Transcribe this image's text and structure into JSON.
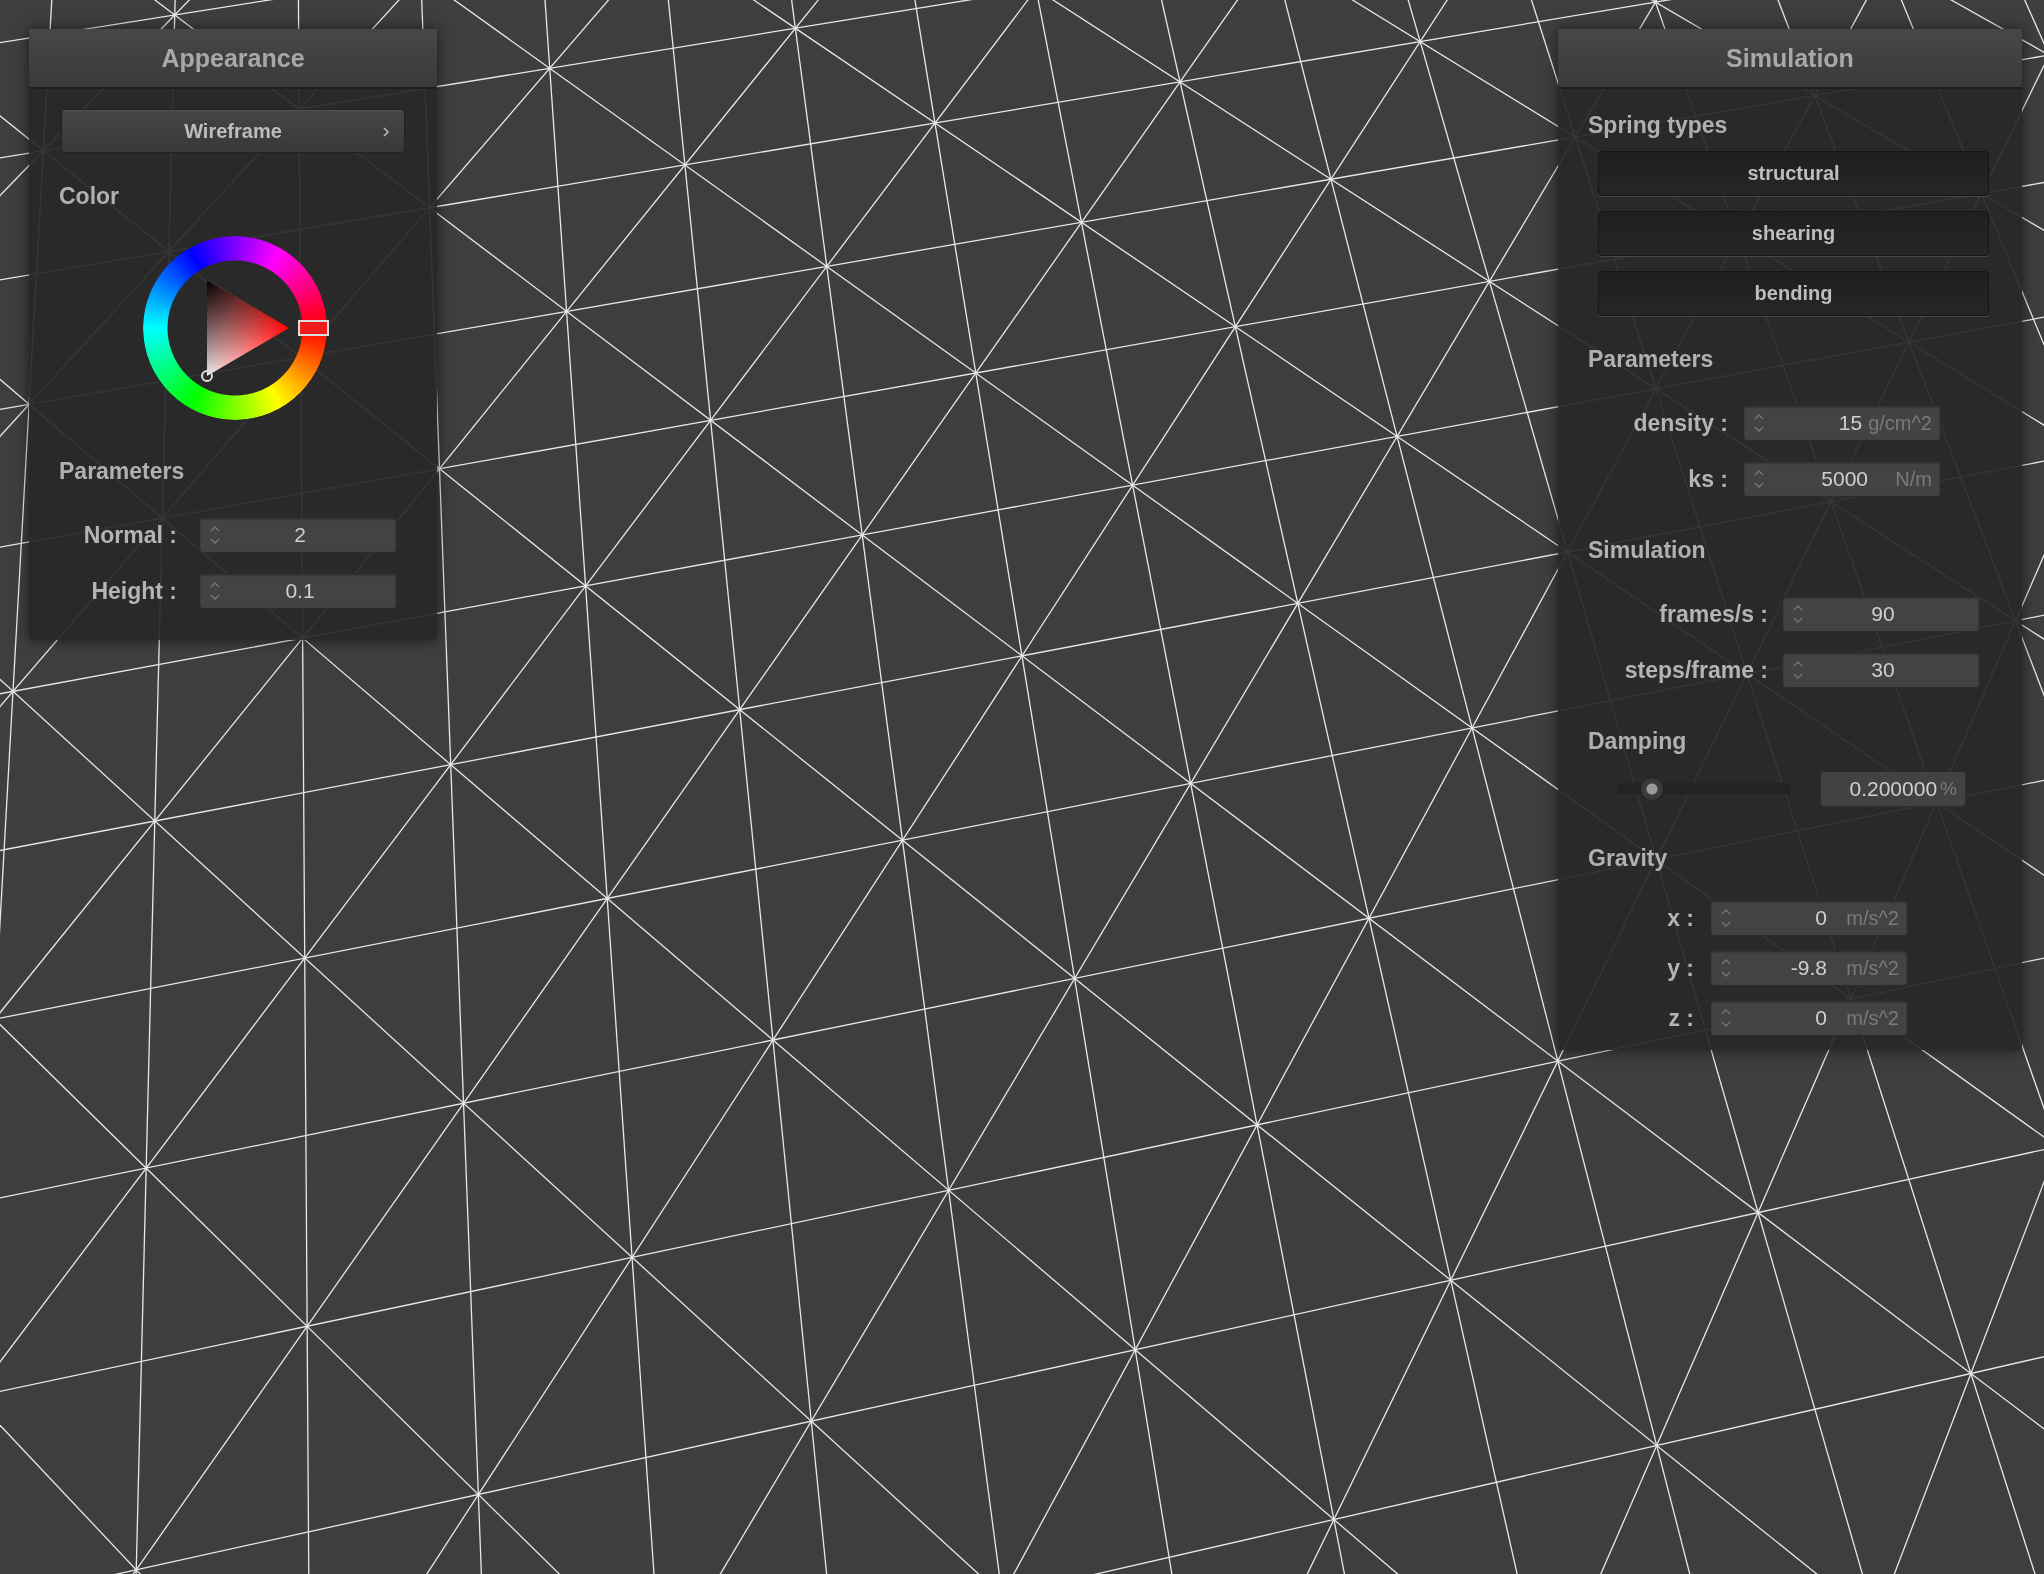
{
  "appearance_panel": {
    "title": "Appearance",
    "mode_button": {
      "label": "Wireframe"
    },
    "color_section": {
      "label": "Color"
    },
    "parameters": {
      "label": "Parameters",
      "fields": [
        {
          "label": "Normal :",
          "value": "2"
        },
        {
          "label": "Height :",
          "value": "0.1"
        }
      ]
    }
  },
  "simulation_panel": {
    "title": "Simulation",
    "spring_types": {
      "label": "Spring types",
      "buttons": [
        {
          "label": "structural",
          "pressed": true
        },
        {
          "label": "shearing",
          "pressed": true
        },
        {
          "label": "bending",
          "pressed": true
        }
      ]
    },
    "parameters": {
      "label": "Parameters",
      "fields": [
        {
          "label": "density :",
          "value": "15",
          "unit": "g/cm^2"
        },
        {
          "label": "ks :",
          "value": "5000",
          "unit": "N/m"
        }
      ]
    },
    "simulation": {
      "label": "Simulation",
      "fields": [
        {
          "label": "frames/s :",
          "value": "90"
        },
        {
          "label": "steps/frame :",
          "value": "30"
        }
      ]
    },
    "damping": {
      "label": "Damping",
      "level": 0.2,
      "value": "0.200000",
      "unit": "%"
    },
    "gravity": {
      "label": "Gravity",
      "fields": [
        {
          "label": "x :",
          "value": "0",
          "unit": "m/s^2"
        },
        {
          "label": "y :",
          "value": "-9.8",
          "unit": "m/s^2"
        },
        {
          "label": "z :",
          "value": "0",
          "unit": "m/s^2"
        }
      ]
    }
  }
}
